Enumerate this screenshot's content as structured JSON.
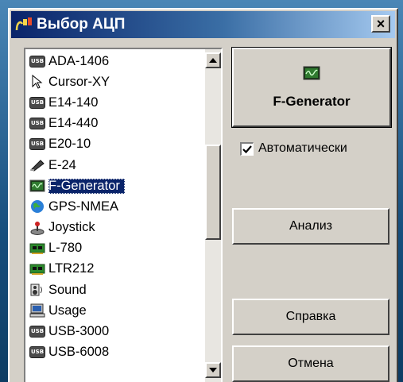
{
  "window": {
    "title": "Выбор АЦП",
    "close_label": "×"
  },
  "device_list": {
    "items": [
      {
        "label": "ADA-1406",
        "icon": "usb-icon"
      },
      {
        "label": "Cursor-XY",
        "icon": "cursor-icon"
      },
      {
        "label": "E14-140",
        "icon": "usb-icon"
      },
      {
        "label": "E14-440",
        "icon": "usb-icon"
      },
      {
        "label": "E20-10",
        "icon": "usb-icon"
      },
      {
        "label": "E-24",
        "icon": "pen-icon"
      },
      {
        "label": "F-Generator",
        "icon": "oscilloscope-icon",
        "selected": true
      },
      {
        "label": "GPS-NMEA",
        "icon": "globe-icon"
      },
      {
        "label": "Joystick",
        "icon": "joystick-icon"
      },
      {
        "label": "L-780",
        "icon": "board-icon"
      },
      {
        "label": "LTR212",
        "icon": "board-icon"
      },
      {
        "label": "Sound",
        "icon": "speaker-icon"
      },
      {
        "label": "Usage",
        "icon": "computer-icon"
      },
      {
        "label": "USB-3000",
        "icon": "usb-icon"
      },
      {
        "label": "USB-6008",
        "icon": "usb-icon"
      }
    ],
    "usb_badge": "USB"
  },
  "buttons": {
    "selected_device_label": "F-Generator",
    "auto_checkbox_label": "Автоматически",
    "auto_checked": true,
    "analysis_label": "Анализ",
    "help_label": "Справка",
    "cancel_label": "Отмена"
  },
  "colors": {
    "selection_bg": "#0a246a",
    "titlebar_start": "#0a246a",
    "titlebar_end": "#a6caf0",
    "dialog_face": "#d4d0c8"
  }
}
